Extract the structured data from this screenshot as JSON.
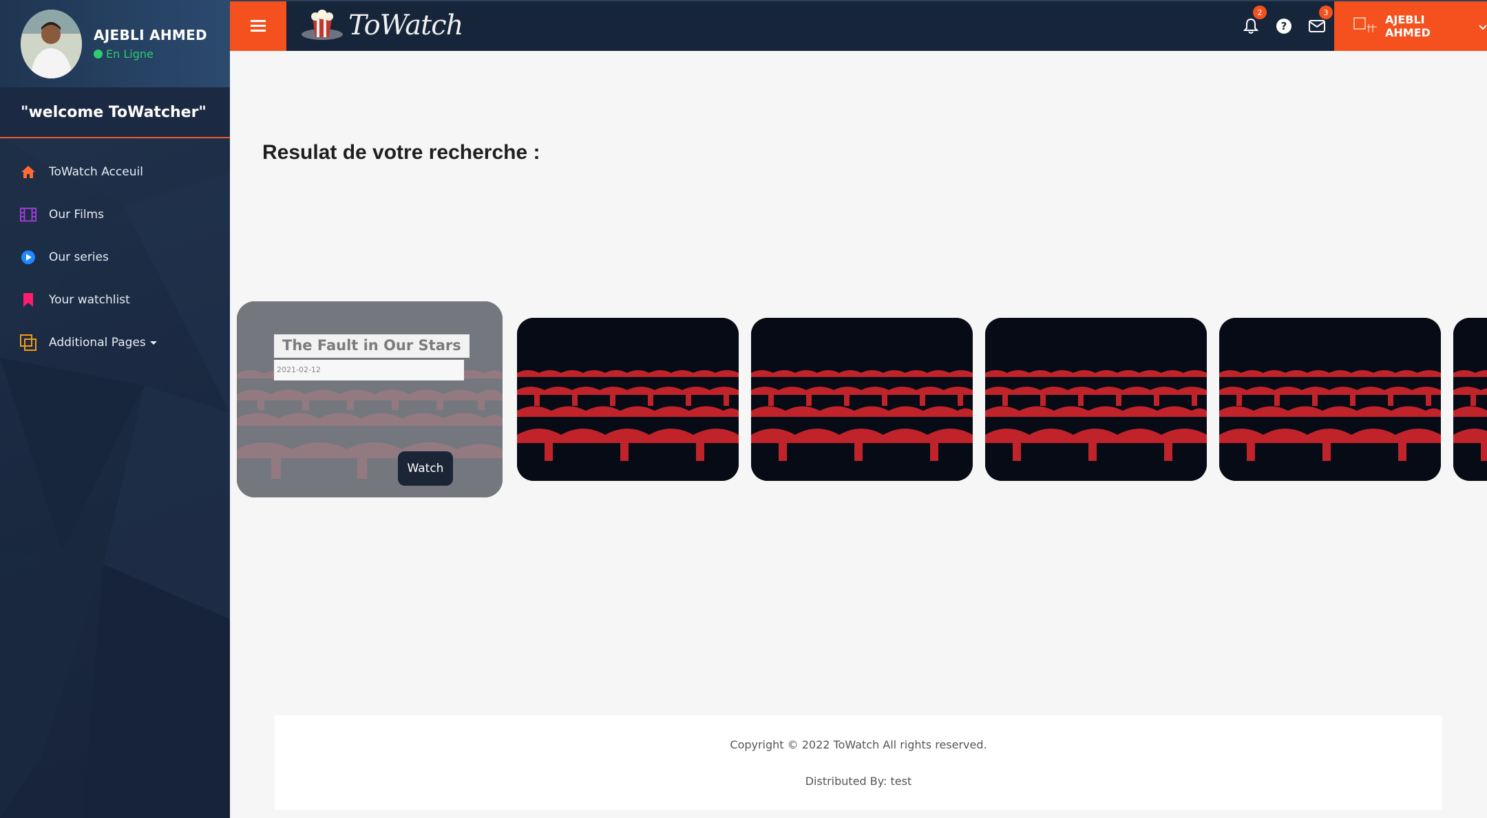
{
  "sidebar": {
    "user_name": "AJEBLI AHMED",
    "status": "En Ligne",
    "welcome": "\"welcome ToWatcher\"",
    "items": [
      {
        "label": "ToWatch Acceuil",
        "icon": "home-icon",
        "color": "#ff6b35"
      },
      {
        "label": "Our Films",
        "icon": "film-icon",
        "color": "#a63ae0"
      },
      {
        "label": "Our series",
        "icon": "play-circle-icon",
        "color": "#1e88ff"
      },
      {
        "label": "Your watchlist",
        "icon": "bookmark-icon",
        "color": "#ff1e6e"
      },
      {
        "label": "Additional Pages",
        "icon": "pages-icon",
        "color": "#f39c12"
      }
    ]
  },
  "topbar": {
    "logo_text": "ToWatch",
    "notifications_count": "2",
    "messages_count": "3",
    "user_name": "AJEBLI AHMED",
    "accent": "#f4511e"
  },
  "main": {
    "search_title": "Resulat de votre recherche :",
    "cards": [
      {
        "title": "The Fault in Our Stars",
        "date": "2021-02-12",
        "button": "Watch"
      }
    ]
  },
  "footer": {
    "copyright": "Copyright © 2022 ToWatch All rights reserved.",
    "distributed": "Distributed By: test"
  }
}
